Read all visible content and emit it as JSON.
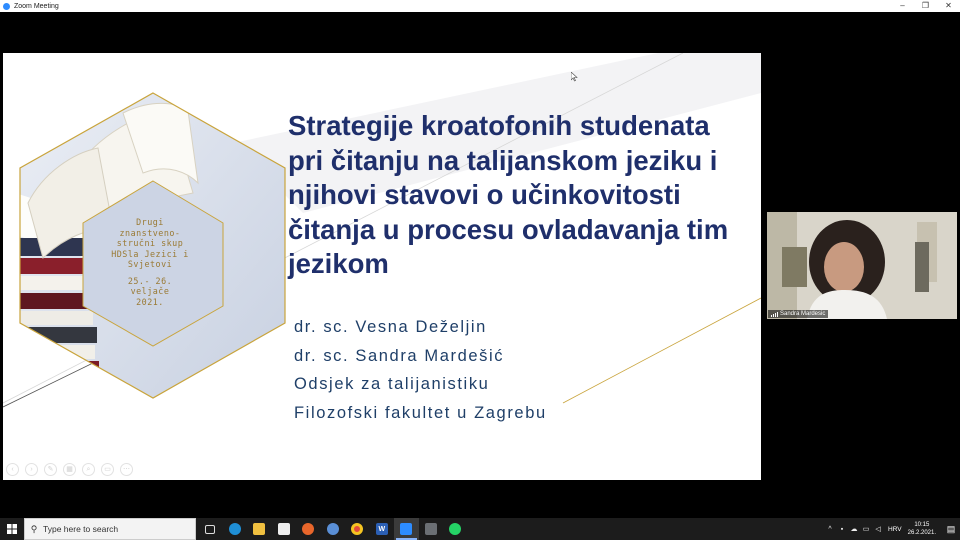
{
  "window": {
    "title": "Zoom Meeting",
    "minimize_glyph": "–",
    "restore_glyph": "❐",
    "close_glyph": "✕"
  },
  "slide": {
    "title": "Strategije kroatofonih studenata pri čitanju na talijanskom jeziku i njihovi stavovi o učinkovitosti čitanja u procesu ovladavanja tim jezikom",
    "authors": [
      "dr. sc. Vesna Deželjin",
      "dr. sc. Sandra Mardešić",
      "Odsjek za talijanistiku",
      "Filozofski fakultet u Zagrebu"
    ],
    "hex_lines": [
      "Drugi",
      "znanstveno-",
      "stručni skup",
      "HDSla Jezici i",
      "Svjetovi"
    ],
    "hex_date_lines": [
      "25.- 26.",
      "veljače",
      "2021."
    ],
    "toolbar_icons": [
      "prev-icon",
      "next-icon",
      "pen-icon",
      "grid-icon",
      "zoom-icon",
      "subtitles-icon",
      "more-icon"
    ],
    "accent_color": "#c9a43c",
    "title_color": "#1f2f6b"
  },
  "participant": {
    "name": "Sandra Mardesic"
  },
  "taskbar": {
    "search_placeholder": "Type here to search",
    "apps": [
      {
        "name": "task-view",
        "label": ""
      },
      {
        "name": "edge",
        "label": ""
      },
      {
        "name": "file-explorer",
        "label": ""
      },
      {
        "name": "store",
        "label": ""
      },
      {
        "name": "firefox",
        "label": ""
      },
      {
        "name": "thunderbird",
        "label": ""
      },
      {
        "name": "chrome",
        "label": ""
      },
      {
        "name": "word",
        "label": "W"
      },
      {
        "name": "zoom",
        "label": ""
      },
      {
        "name": "calculator",
        "label": ""
      },
      {
        "name": "whatsapp",
        "label": ""
      }
    ],
    "language": "HRV",
    "time": "10:15",
    "date": "26.2.2021.",
    "notification_count": "1"
  }
}
